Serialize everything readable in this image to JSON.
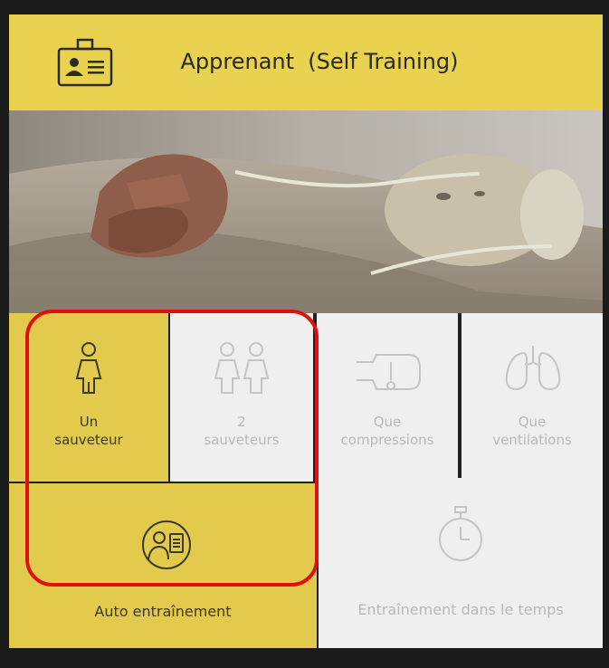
{
  "header": {
    "title": "Apprenant  (Self Training)",
    "icon": "id-card-icon"
  },
  "tiles": {
    "un_sauveteur": {
      "line1": "Un",
      "line2": "sauveteur",
      "icon": "single-person-icon"
    },
    "deux_sauveteurs": {
      "line1": "2",
      "line2": "sauveteurs",
      "icon": "two-persons-icon"
    },
    "que_compressions": {
      "line1": "Que",
      "line2": "compressions",
      "icon": "compression-icon"
    },
    "que_ventilations": {
      "line1": "Que",
      "line2": "ventilations",
      "icon": "lungs-icon"
    },
    "auto_entrainement": {
      "label": "Auto entraînement",
      "icon": "self-training-icon"
    },
    "entrainement_temps": {
      "label": "Entraînement dans le temps",
      "icon": "stopwatch-icon"
    }
  },
  "colors": {
    "accent_yellow": "#e9d24f",
    "tile_yellow": "#e2ca4c",
    "tile_white": "#efefef",
    "highlight_red": "#e01010"
  }
}
